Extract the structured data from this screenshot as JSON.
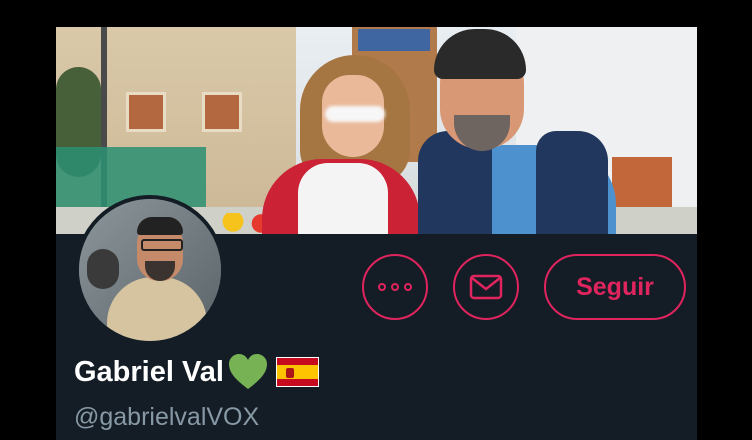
{
  "profile": {
    "display_name": "Gabriel Val",
    "handle": "@gabrielvalVOX",
    "emoji": [
      "green-heart",
      "spain-flag"
    ]
  },
  "actions": {
    "more_icon": "more-options-icon",
    "message_icon": "envelope-icon",
    "follow_label": "Seguir"
  },
  "colors": {
    "accent": "#e0245e",
    "background": "#141d26",
    "name": "#ffffff",
    "handle": "#8899a6",
    "heart": "#77b255"
  }
}
